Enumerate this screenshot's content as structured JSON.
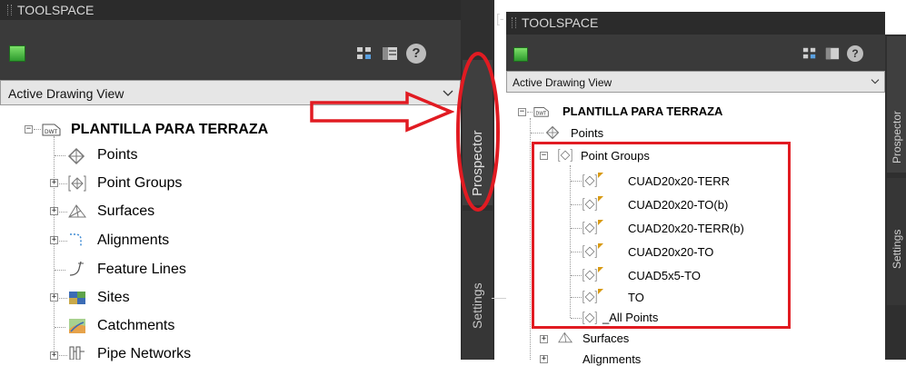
{
  "left_panel": {
    "title": "TOOLSPACE",
    "dropdown_value": "Active Drawing View",
    "root_label": "PLANTILLA PARA TERRAZA",
    "dwt_badge": "DWT",
    "items": [
      "Points",
      "Point Groups",
      "Surfaces",
      "Alignments",
      "Feature Lines",
      "Sites",
      "Catchments",
      "Pipe Networks"
    ]
  },
  "right_panel": {
    "title": "TOOLSPACE",
    "bracket_text": "[-",
    "dropdown_value": "Active Drawing View",
    "root_label": "PLANTILLA PARA TERRAZA",
    "dwt_badge": "DWT",
    "points_label": "Points",
    "point_groups_label": "Point Groups",
    "groups": [
      "CUAD20x20-TERR",
      "CUAD20x20-TO(b)",
      "CUAD20x20-TERR(b)",
      "CUAD20x20-TO",
      "CUAD5x5-TO",
      "TO"
    ],
    "all_points_label": "_All Points",
    "surfaces_label": "Surfaces",
    "alignments_label": "Alignments"
  },
  "tabs": {
    "left_prospector": "Prospector",
    "left_settings": "Settings",
    "right_prospector": "Prospector",
    "right_settings": "Settings"
  },
  "toolbar": {
    "help_symbol": "?"
  },
  "annotation_colors": {
    "arrow": "#e11b22",
    "ellipse": "#e11b22",
    "highlight_box": "#e11b22"
  },
  "icons": [
    "drawing-cube-icon",
    "item-view-icon",
    "panorama-icon",
    "help-icon",
    "dwt-file-icon",
    "point-icon",
    "point-group-icon",
    "surface-icon",
    "alignment-icon",
    "feature-line-icon",
    "site-icon",
    "catchment-icon",
    "pipe-network-icon"
  ]
}
